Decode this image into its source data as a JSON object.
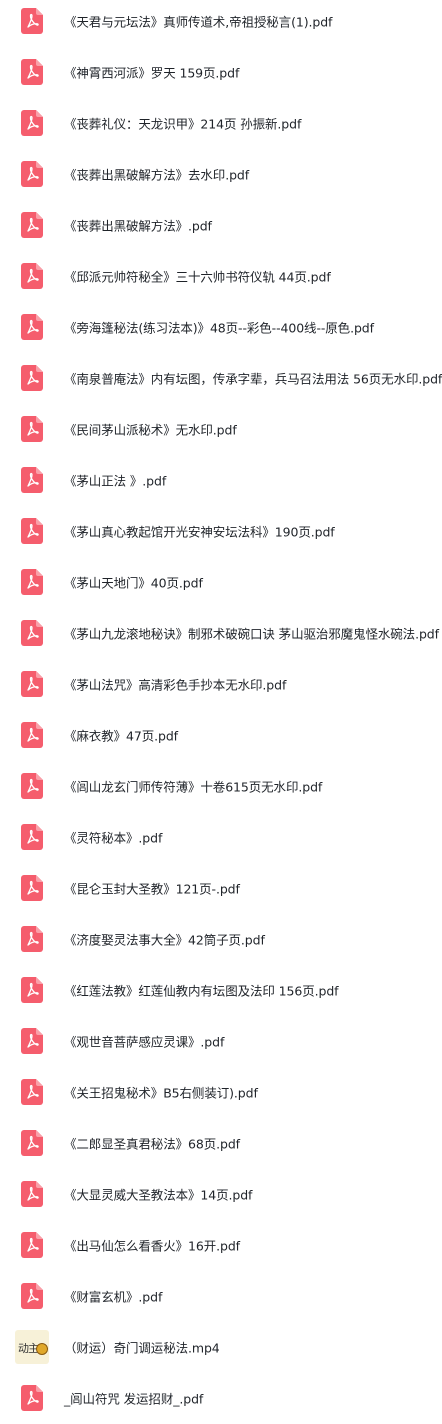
{
  "accent_color": "#f55d6d",
  "files": [
    {
      "name": "《天君与元坛法》真师传道术,帝祖授秘言(1).pdf",
      "icon": "pdf-icon"
    },
    {
      "name": "《神霄西河派》罗天 159页.pdf",
      "icon": "pdf-icon"
    },
    {
      "name": "《丧葬礼仪：天龙识甲》214页 孙振新.pdf",
      "icon": "pdf-icon"
    },
    {
      "name": "《丧葬出黑破解方法》去水印.pdf",
      "icon": "pdf-icon"
    },
    {
      "name": "《丧葬出黑破解方法》.pdf",
      "icon": "pdf-icon"
    },
    {
      "name": "《邱派元帅符秘全》三十六帅书符仪轨 44页.pdf",
      "icon": "pdf-icon"
    },
    {
      "name": "《旁海篷秘法(练习法本)》48页--彩色--400线--原色.pdf",
      "icon": "pdf-icon"
    },
    {
      "name": "《南泉普庵法》内有坛图，传承字辈，兵马召法用法 56页无水印.pdf",
      "icon": "pdf-icon"
    },
    {
      "name": "《民间茅山派秘术》无水印.pdf",
      "icon": "pdf-icon"
    },
    {
      "name": "《茅山正法 》.pdf",
      "icon": "pdf-icon"
    },
    {
      "name": "《茅山真心教起馆开光安神安坛法科》190页.pdf",
      "icon": "pdf-icon"
    },
    {
      "name": "《茅山天地门》40页.pdf",
      "icon": "pdf-icon"
    },
    {
      "name": "《茅山九龙滚地秘诀》制邪术破碗口诀 茅山驱治邪魔鬼怪水碗法.pdf",
      "icon": "pdf-icon"
    },
    {
      "name": "《茅山法咒》高清彩色手抄本无水印.pdf",
      "icon": "pdf-icon"
    },
    {
      "name": "《麻衣教》47页.pdf",
      "icon": "pdf-icon"
    },
    {
      "name": "《闾山龙玄门师传符薄》十卷615页无水印.pdf",
      "icon": "pdf-icon"
    },
    {
      "name": "《灵符秘本》.pdf",
      "icon": "pdf-icon"
    },
    {
      "name": "《昆仑玉封大圣教》121页-.pdf",
      "icon": "pdf-icon"
    },
    {
      "name": "《济度娶灵法事大全》42筒子页.pdf",
      "icon": "pdf-icon"
    },
    {
      "name": "《红莲法教》红莲仙教内有坛图及法印 156页.pdf",
      "icon": "pdf-icon"
    },
    {
      "name": "《观世音菩萨感应灵课》.pdf",
      "icon": "pdf-icon"
    },
    {
      "name": "《关王招鬼秘术》B5右侧装订).pdf",
      "icon": "pdf-icon"
    },
    {
      "name": "《二郎显圣真君秘法》68页.pdf",
      "icon": "pdf-icon"
    },
    {
      "name": "《大显灵威大圣教法本》14页.pdf",
      "icon": "pdf-icon"
    },
    {
      "name": "《出马仙怎么看香火》16开.pdf",
      "icon": "pdf-icon"
    },
    {
      "name": "《财富玄机》.pdf",
      "icon": "pdf-icon"
    },
    {
      "name": "（财运）奇门调运秘法.mp4",
      "icon": "video-thumbnail-icon",
      "thumb_text": "动主"
    },
    {
      "name": "_闾山符咒 发运招财_.pdf",
      "icon": "pdf-icon"
    }
  ]
}
